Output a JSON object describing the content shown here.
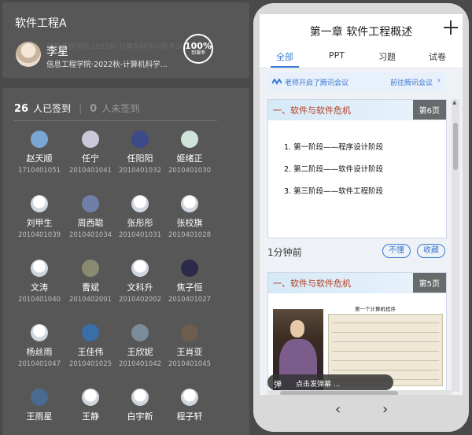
{
  "course": {
    "title": "软件工程A",
    "ghost_text": "信息工程学院 2022秋-计算机科学与技术2002班",
    "teacher_name": "李星",
    "teacher_dept": "信息工程学院·2022秋-计算机科学...",
    "rate_value": "100%",
    "rate_label": "到课率"
  },
  "attendance": {
    "signed_count": "26",
    "signed_label": "人已签到",
    "unsigned_count": "0",
    "unsigned_label": "人未签到"
  },
  "students": [
    {
      "name": "赵天顺",
      "id": "1710401051",
      "avatar": "photo"
    },
    {
      "name": "任宁",
      "id": "2010401041",
      "avatar": "photo"
    },
    {
      "name": "任阳阳",
      "id": "2010401032",
      "avatar": "photo"
    },
    {
      "name": "姬绪正",
      "id": "2010401030",
      "avatar": "photo"
    },
    {
      "name": "刘甲生",
      "id": "2010401039",
      "avatar": "default"
    },
    {
      "name": "周西聪",
      "id": "2010401034",
      "avatar": "photo"
    },
    {
      "name": "张彤彤",
      "id": "2010401031",
      "avatar": "default"
    },
    {
      "name": "张校旗",
      "id": "2010401028",
      "avatar": "default"
    },
    {
      "name": "文涛",
      "id": "2010401040",
      "avatar": "default"
    },
    {
      "name": "曹斌",
      "id": "2010402001",
      "avatar": "photo"
    },
    {
      "name": "文科升",
      "id": "2010402002",
      "avatar": "default"
    },
    {
      "name": "焦子恒",
      "id": "2010401027",
      "avatar": "photo"
    },
    {
      "name": "杨丝雨",
      "id": "2010401047",
      "avatar": "default"
    },
    {
      "name": "王佳伟",
      "id": "2010401025",
      "avatar": "photo"
    },
    {
      "name": "王欣妮",
      "id": "2010401042",
      "avatar": "photo"
    },
    {
      "name": "王肖亚",
      "id": "2010401045",
      "avatar": "photo"
    },
    {
      "name": "王雨星",
      "id": "",
      "avatar": "photo"
    },
    {
      "name": "王静",
      "id": "",
      "avatar": "default"
    },
    {
      "name": "白宇新",
      "id": "",
      "avatar": "default"
    },
    {
      "name": "程子轩",
      "id": "",
      "avatar": "default"
    }
  ],
  "phone": {
    "title": "第一章 软件工程概述",
    "tabs": [
      "全部",
      "PPT",
      "习题",
      "试卷"
    ],
    "meeting_text": "老师开启了腾讯会议",
    "meeting_link": "前往腾讯会议",
    "slide1": {
      "heading": "一、软件与软件危机",
      "page": "第6页",
      "items": [
        "1.  第一阶段——程序设计阶段",
        "2.  第二阶段——软件设计阶段",
        "3.  第三阶段——软件工程阶段"
      ]
    },
    "time_ago": "1分钟前",
    "btn_unclear": "不懂",
    "btn_collect": "收藏",
    "slide2": {
      "heading": "一、软件与软件危机",
      "page": "第5页",
      "table_title": "第一个计算机程序"
    },
    "danmaku_icon": "弹",
    "danmaku_placeholder": "点击发弹幕 ...",
    "nav_prev": "‹",
    "nav_next": "›"
  },
  "colors": {
    "accent": "#3a7bd5",
    "panel": "#575757",
    "background": "#4a4a4a"
  }
}
